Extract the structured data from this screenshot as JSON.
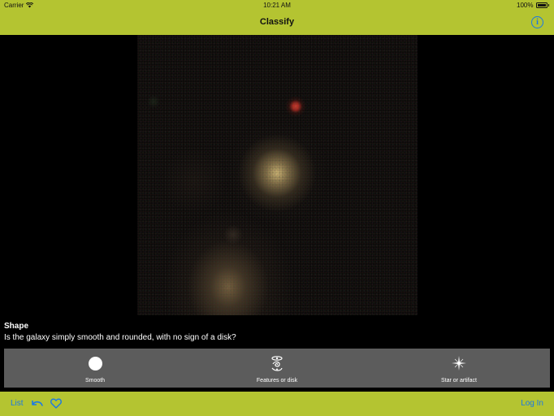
{
  "status_bar": {
    "carrier": "Carrier",
    "time": "10:21 AM",
    "battery": "100%"
  },
  "nav": {
    "title": "Classify",
    "info_icon": "info-circle-icon"
  },
  "question": {
    "title": "Shape",
    "text": "Is the galaxy simply smooth and rounded, with no sign of a disk?"
  },
  "answers": [
    {
      "label": "Smooth",
      "icon": "smooth-circle-icon"
    },
    {
      "label": "Features or disk",
      "icon": "spiral-galaxy-icon"
    },
    {
      "label": "Star or artifact",
      "icon": "star-sparkle-icon"
    }
  ],
  "toolbar": {
    "list_label": "List",
    "undo_icon": "undo-icon",
    "favorite_icon": "heart-icon",
    "login_label": "Log In"
  },
  "colors": {
    "accent_bar": "#b4c431",
    "link_blue": "#1a78e6",
    "answer_panel": "#5c5c5c",
    "background": "#000000"
  }
}
